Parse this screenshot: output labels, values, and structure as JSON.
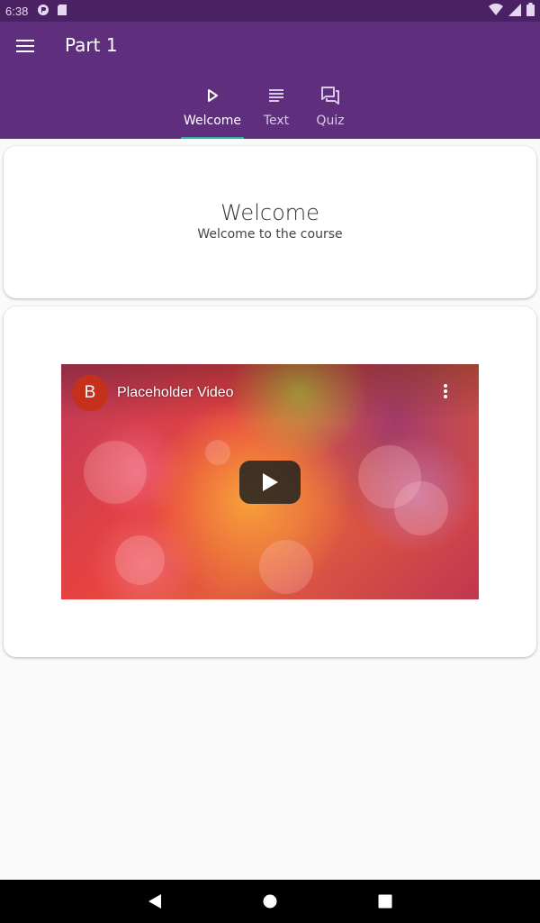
{
  "status_bar": {
    "time": "6:38"
  },
  "app_bar": {
    "title": "Part 1"
  },
  "tabs": [
    {
      "label": "Welcome",
      "icon": "play-icon",
      "active": true
    },
    {
      "label": "Text",
      "icon": "text-lines-icon",
      "active": false
    },
    {
      "label": "Quiz",
      "icon": "chat-bubbles-icon",
      "active": false
    }
  ],
  "welcome_card": {
    "heading": "Welcome",
    "subtitle": "Welcome to the course"
  },
  "video": {
    "channel_initial": "B",
    "title": "Placeholder Video"
  },
  "colors": {
    "app_bar": "#5f2f7e",
    "status_bar": "#4a2264",
    "tab_indicator": "#2bb3a8",
    "channel_avatar": "#c4301a"
  }
}
